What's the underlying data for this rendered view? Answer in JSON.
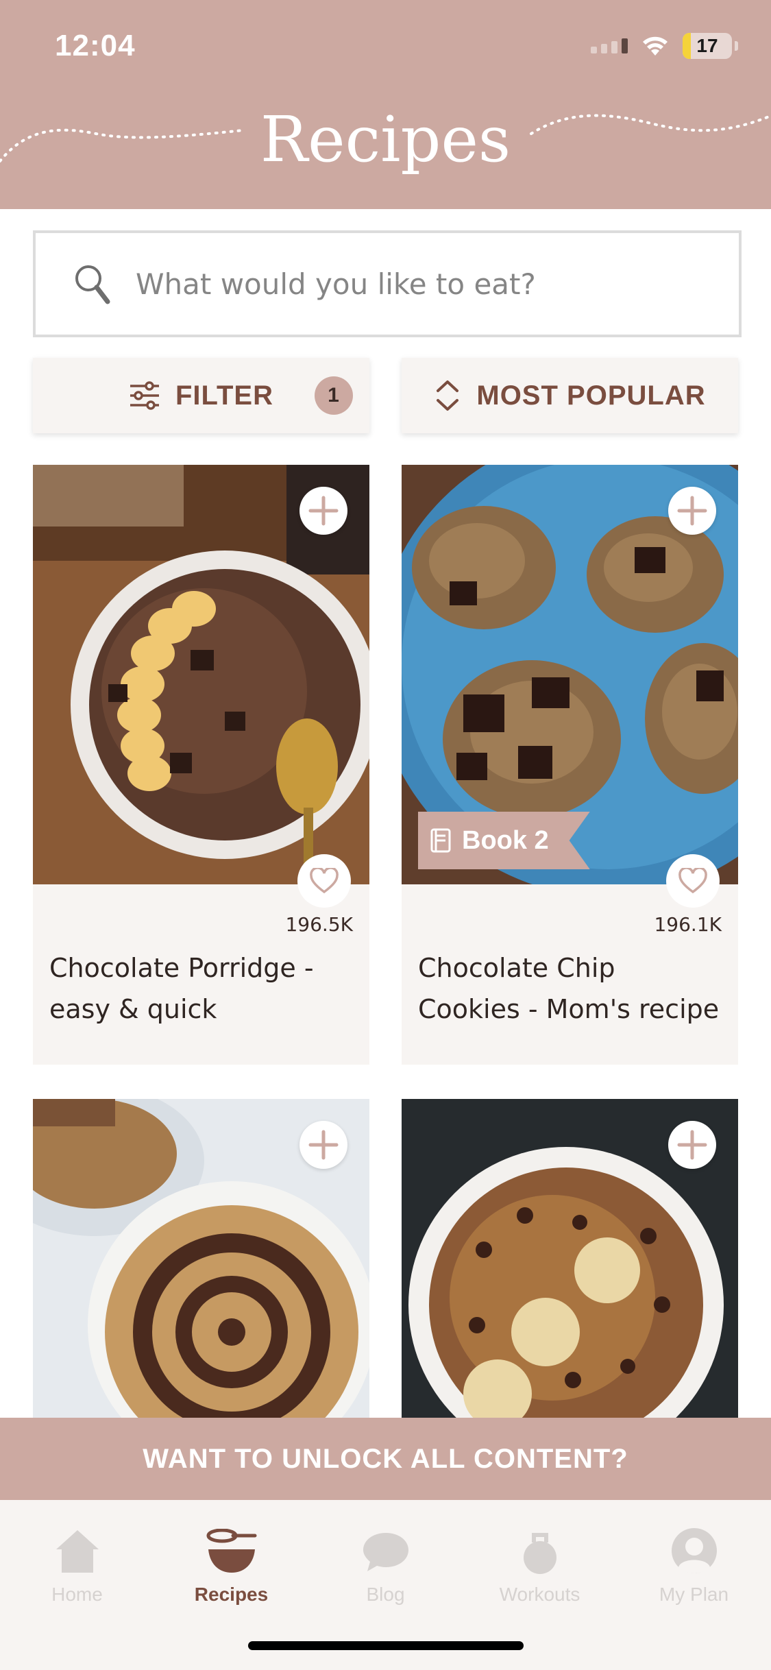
{
  "status_bar": {
    "time": "12:04",
    "battery": "17",
    "battery_level": 0.17
  },
  "header": {
    "title": "Recipes"
  },
  "search": {
    "placeholder": "What would you like to eat?"
  },
  "filter": {
    "label": "FILTER",
    "count": "1"
  },
  "sort": {
    "label": "MOST POPULAR"
  },
  "recipes": [
    {
      "title": "Chocolate Porridge - easy & quick",
      "likes": "196.5K",
      "book": ""
    },
    {
      "title": "Chocolate Chip Cookies - Mom's recipe",
      "likes": "196.1K",
      "book": "Book 2"
    },
    {
      "title": "",
      "likes": "",
      "book": ""
    },
    {
      "title": "",
      "likes": "",
      "book": ""
    }
  ],
  "unlock_banner": {
    "label": "WANT TO UNLOCK ALL CONTENT?"
  },
  "tabs": [
    {
      "label": "Home",
      "icon": "home-icon"
    },
    {
      "label": "Recipes",
      "icon": "bowl-whisk-icon"
    },
    {
      "label": "Blog",
      "icon": "chat-bubble-icon"
    },
    {
      "label": "Workouts",
      "icon": "kettlebell-icon"
    },
    {
      "label": "My Plan",
      "icon": "user-icon"
    }
  ],
  "colors": {
    "brand": "#cca9a1",
    "accent_text": "#7a4d3f",
    "card_bg": "#f7f4f2",
    "active_tab": "#7a4d3f",
    "inactive_tab": "#d6d2d0"
  }
}
